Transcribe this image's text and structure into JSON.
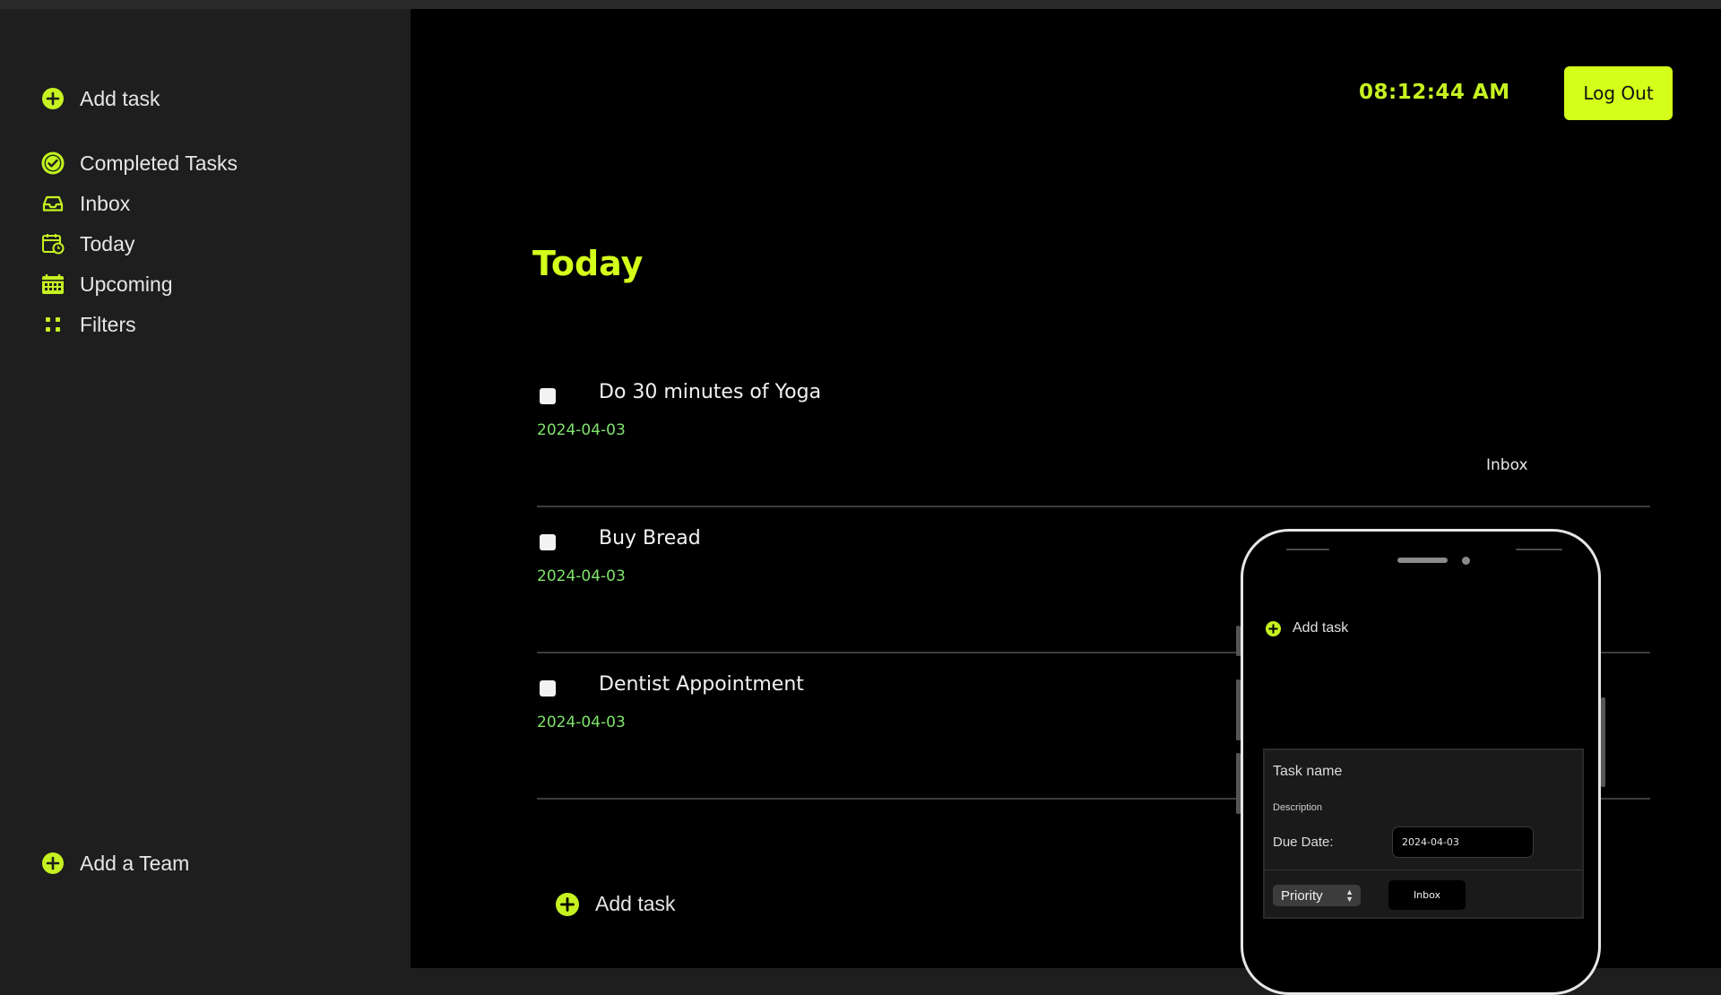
{
  "sidebar": {
    "add_task": "Add task",
    "items": [
      {
        "label": "Completed Tasks",
        "icon": "check-circle-icon"
      },
      {
        "label": "Inbox",
        "icon": "inbox-icon"
      },
      {
        "label": "Today",
        "icon": "calendar-clock-icon"
      },
      {
        "label": "Upcoming",
        "icon": "calendar-grid-icon"
      },
      {
        "label": "Filters",
        "icon": "grid-dots-icon"
      }
    ],
    "add_team": "Add a Team"
  },
  "header": {
    "clock": "08:12:44 AM",
    "logout_label": "Log Out"
  },
  "main": {
    "title": "Today",
    "tasks": [
      {
        "name": "Do 30 minutes of Yoga",
        "date": "2024-04-03",
        "project": "Inbox"
      },
      {
        "name": "Buy Bread",
        "date": "2024-04-03",
        "project": ""
      },
      {
        "name": "Dentist Appointment",
        "date": "2024-04-03",
        "project": ""
      }
    ],
    "add_task": "Add task"
  },
  "phone": {
    "add_task": "Add task",
    "form": {
      "task_name": "Task name",
      "description": "Description",
      "due_date_label": "Due Date:",
      "due_date_value": "2024-04-03",
      "priority": "Priority",
      "project": "Inbox"
    }
  },
  "colors": {
    "accent": "#d4ff1a",
    "date": "#7ee36b",
    "sidebar_bg": "#1e1e1e",
    "main_bg": "#000000"
  }
}
